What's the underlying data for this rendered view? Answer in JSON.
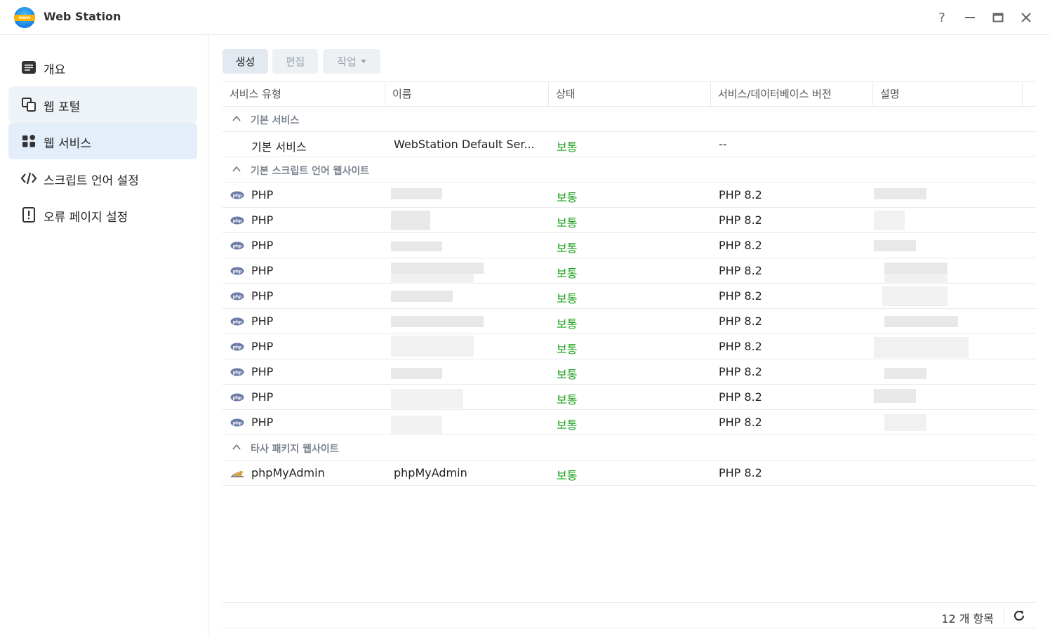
{
  "window": {
    "title": "Web Station",
    "logo_text": "www",
    "help_glyph": "?",
    "minimize_glyph": "—",
    "close_glyph": "✕"
  },
  "sidebar": {
    "items": [
      {
        "label": "개요",
        "icon": "overview-icon"
      },
      {
        "label": "웹 포털",
        "icon": "web-portal-icon"
      },
      {
        "label": "웹 서비스",
        "icon": "web-service-icon"
      },
      {
        "label": "스크립트 언어 설정",
        "icon": "code-icon"
      },
      {
        "label": "오류 페이지 설정",
        "icon": "error-page-icon"
      }
    ]
  },
  "toolbar": {
    "create": "생성",
    "edit": "편집",
    "action": "작업"
  },
  "table": {
    "columns": [
      "서비스 유형",
      "이름",
      "상태",
      "서비스/데이터베이스 버전",
      "설명"
    ],
    "groups": [
      {
        "label": "기본 서비스",
        "rows": [
          {
            "type": "기본 서비스",
            "name": "WebStation Default Ser...",
            "status": "보통",
            "version": "--",
            "description": ""
          }
        ]
      },
      {
        "label": "기본 스크립트 언어 웹사이트",
        "rows": [
          {
            "type": "PHP",
            "name": "",
            "status": "보통",
            "version": "PHP 8.2",
            "description": ""
          },
          {
            "type": "PHP",
            "name": "",
            "status": "보통",
            "version": "PHP 8.2",
            "description": ""
          },
          {
            "type": "PHP",
            "name": "",
            "status": "보통",
            "version": "PHP 8.2",
            "description": ""
          },
          {
            "type": "PHP",
            "name": "",
            "status": "보통",
            "version": "PHP 8.2",
            "description": ""
          },
          {
            "type": "PHP",
            "name": "",
            "status": "보통",
            "version": "PHP 8.2",
            "description": ""
          },
          {
            "type": "PHP",
            "name": "",
            "status": "보통",
            "version": "PHP 8.2",
            "description": ""
          },
          {
            "type": "PHP",
            "name": "",
            "status": "보통",
            "version": "PHP 8.2",
            "description": ""
          },
          {
            "type": "PHP",
            "name": "",
            "status": "보통",
            "version": "PHP 8.2",
            "description": ""
          },
          {
            "type": "PHP",
            "name": "",
            "status": "보통",
            "version": "PHP 8.2",
            "description": ""
          },
          {
            "type": "PHP",
            "name": "",
            "status": "보통",
            "version": "PHP 8.2",
            "description": ""
          }
        ]
      },
      {
        "label": "타사 패키지 웹사이트",
        "rows": [
          {
            "type": "phpMyAdmin",
            "name": "phpMyAdmin",
            "status": "보통",
            "version": "PHP 8.2",
            "description": ""
          }
        ]
      }
    ]
  },
  "footer": {
    "count_label": "12 개 항목"
  },
  "colors": {
    "status_ok": "#18a218",
    "active_nav_bg": "#e3eefa",
    "accent": "#1e88e5"
  }
}
